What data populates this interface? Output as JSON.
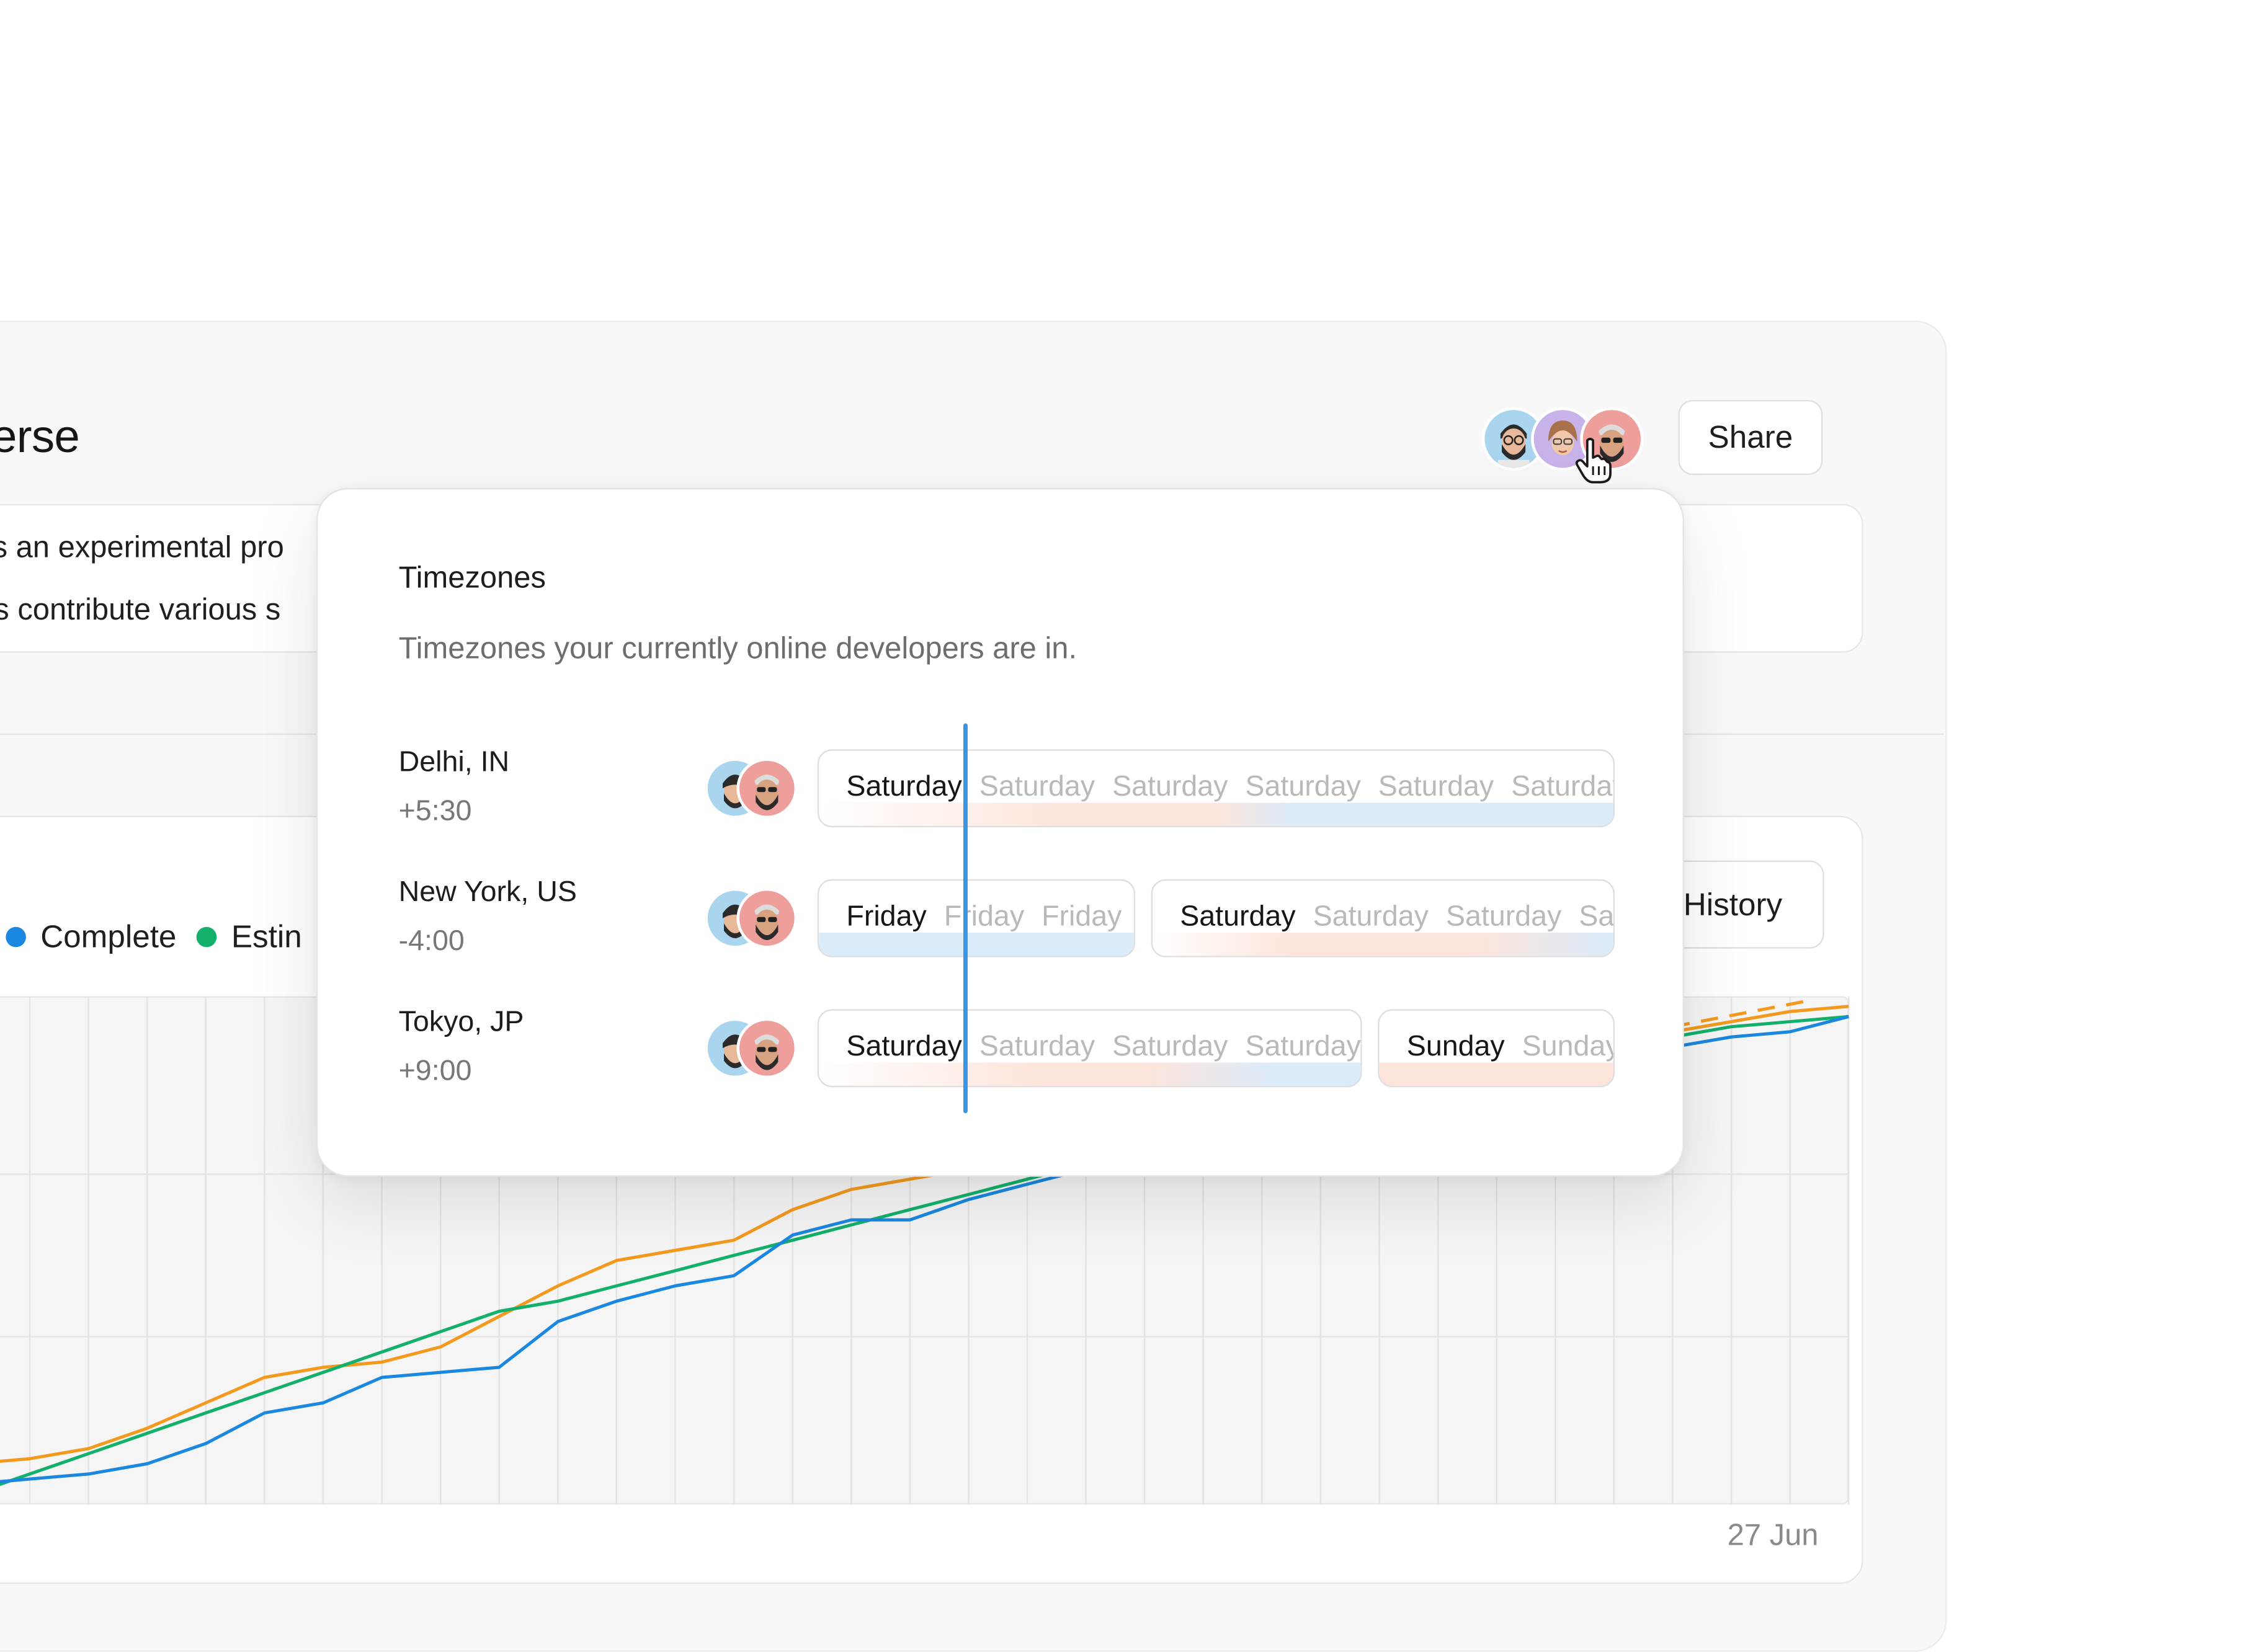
{
  "project": {
    "title_fragment": "erse",
    "description_line1": " is an experimental pro",
    "description_line2": "ts contribute various s"
  },
  "header": {
    "share_label": "Share"
  },
  "chart_card": {
    "history_label": "History",
    "legend": [
      {
        "label": "Complete",
        "color": "#1a88e0"
      },
      {
        "label": "Estin",
        "color": "#12b06a"
      }
    ],
    "x_end_label": "27 Jun"
  },
  "chart_data": {
    "type": "line",
    "x_end_label": "27 Jun",
    "grid": true,
    "series": [
      {
        "name": "Complete",
        "color": "#1a88e0",
        "values": [
          4,
          5,
          6,
          8,
          12,
          18,
          20,
          25,
          26,
          27,
          36,
          40,
          43,
          45,
          53,
          56,
          56,
          60,
          63,
          66,
          68,
          71,
          73,
          76,
          78,
          81,
          84,
          86,
          88,
          90,
          92,
          93,
          96
        ]
      },
      {
        "name": "Estin",
        "color": "#12b06a",
        "values": [
          2,
          6,
          10,
          14,
          18,
          22,
          26,
          30,
          34,
          38,
          40,
          43,
          46,
          49,
          52,
          55,
          58,
          61,
          64,
          67,
          70,
          73,
          75,
          78,
          81,
          84,
          86,
          88,
          90,
          92,
          94,
          95,
          96
        ]
      },
      {
        "name": "",
        "color": "#f39a1e",
        "values": [
          8,
          9,
          11,
          15,
          20,
          25,
          27,
          28,
          31,
          37,
          43,
          48,
          50,
          52,
          58,
          62,
          64,
          66,
          68,
          70,
          72,
          75,
          77,
          80,
          82,
          85,
          87,
          89,
          91,
          93,
          95,
          97,
          98
        ]
      }
    ]
  },
  "popover": {
    "title": "Timezones",
    "subtitle": "Timezones your currently online developers are in.",
    "rows": [
      {
        "city": "Delhi, IN",
        "offset": "+5:30",
        "pills": [
          {
            "strong": "Saturday",
            "faint": [
              "Saturday",
              "Saturday",
              "Saturday",
              "Saturday",
              "Saturday"
            ]
          }
        ]
      },
      {
        "city": "New York, US",
        "offset": "-4:00",
        "pills": [
          {
            "strong": "Friday",
            "faint": [
              "Friday",
              "Friday"
            ]
          },
          {
            "strong": "Saturday",
            "faint": [
              "Saturday",
              "Saturday",
              "Saturday"
            ]
          }
        ]
      },
      {
        "city": "Tokyo, JP",
        "offset": "+9:00",
        "pills": [
          {
            "strong": "Saturday",
            "faint": [
              "Saturday",
              "Saturday",
              "Saturday"
            ]
          },
          {
            "strong": "Sunday",
            "faint": [
              "Sunday"
            ]
          }
        ]
      }
    ]
  },
  "icons": {
    "avatar_1": "bearded-glasses-avatar-icon",
    "avatar_2": "woman-glasses-avatar-icon",
    "avatar_3": "bearded-sunglasses-avatar-icon",
    "cursor": "hand-pointer-icon"
  }
}
